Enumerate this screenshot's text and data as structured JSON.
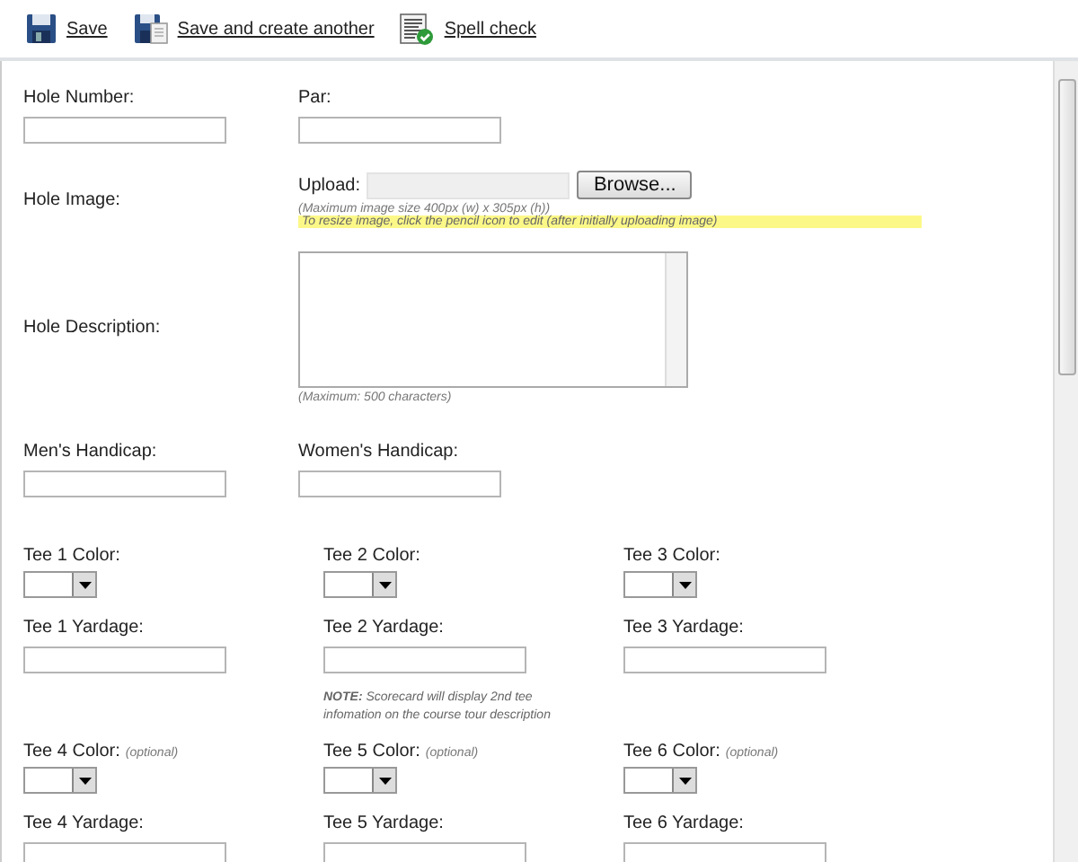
{
  "toolbar": [
    {
      "label": "Save"
    },
    {
      "label": "Save and create another"
    },
    {
      "label": "Spell check"
    }
  ],
  "hole_fields": [
    {
      "label": "Hole Number:"
    },
    {
      "label": "Par:"
    }
  ],
  "hole_image": {
    "label": "Hole Image:",
    "upload_label": "Upload:",
    "button": "Browse...",
    "size_hint": "(Maximum image size 400px (w) x 305px (h))",
    "resize_hint": "To resize image, click the pencil icon to edit (after initially uploading image)"
  },
  "hole_description": {
    "label": "Hole Description:",
    "hint": "(Maximum: 500 characters)"
  },
  "handicaps": [
    {
      "label": "Men's Handicap:"
    },
    {
      "label": "Women's Handicap:"
    }
  ],
  "tees_top": [
    {
      "color_label": "Tee 1 Color:",
      "yardage_label": "Tee 1 Yardage:"
    },
    {
      "color_label": "Tee 2 Color:",
      "yardage_label": "Tee 2 Yardage:"
    },
    {
      "color_label": "Tee 3 Color:",
      "yardage_label": "Tee 3 Yardage:"
    }
  ],
  "note": "**NOTE:** Scorecard will display 2nd tee infomation on the course tour description",
  "tees_bottom": [
    {
      "color_label": "Tee 4 Color:",
      "optional": "(optional)",
      "yardage_label": "Tee 4 Yardage:"
    },
    {
      "color_label": "Tee 5 Color:",
      "optional": "(optional)",
      "yardage_label": "Tee 5 Yardage:"
    },
    {
      "color_label": "Tee 6 Color:",
      "optional": "(optional)",
      "yardage_label": "Tee 6 Yardage:"
    }
  ]
}
